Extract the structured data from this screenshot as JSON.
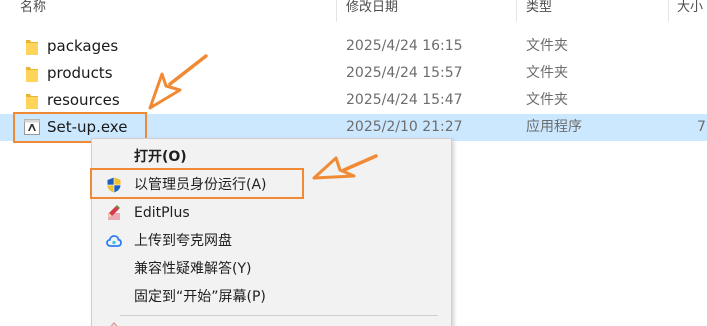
{
  "header": {
    "col_name": "名称",
    "col_date": "修改日期",
    "col_type": "类型",
    "col_size": "大小"
  },
  "files": [
    {
      "name": "packages",
      "date": "2025/4/24 16:15",
      "type": "文件夹",
      "icon": "folder-icon"
    },
    {
      "name": "products",
      "date": "2025/4/24 15:57",
      "type": "文件夹",
      "icon": "folder-icon"
    },
    {
      "name": "resources",
      "date": "2025/4/24 15:47",
      "type": "文件夹",
      "icon": "folder-icon"
    },
    {
      "name": "Set-up.exe",
      "date": "2025/2/10 21:27",
      "type": "应用程序",
      "size": "7,",
      "icon": "adobe-setup-icon",
      "selected": true
    }
  ],
  "context_menu": {
    "items": [
      {
        "label": "打开(O)",
        "bold": true,
        "icon": ""
      },
      {
        "label": "以管理员身份运行(A)",
        "icon": "uac-shield-icon"
      },
      {
        "label": "EditPlus",
        "icon": "editplus-icon"
      },
      {
        "label": "上传到夸克网盘",
        "icon": "quark-cloud-icon"
      },
      {
        "label": "兼容性疑难解答(Y)",
        "icon": ""
      },
      {
        "label": "固定到“开始”屏幕(P)",
        "icon": ""
      }
    ]
  },
  "colors": {
    "selection": "#cce8ff",
    "highlight": "#f08a34",
    "menu_background": "#f2f2f2"
  }
}
